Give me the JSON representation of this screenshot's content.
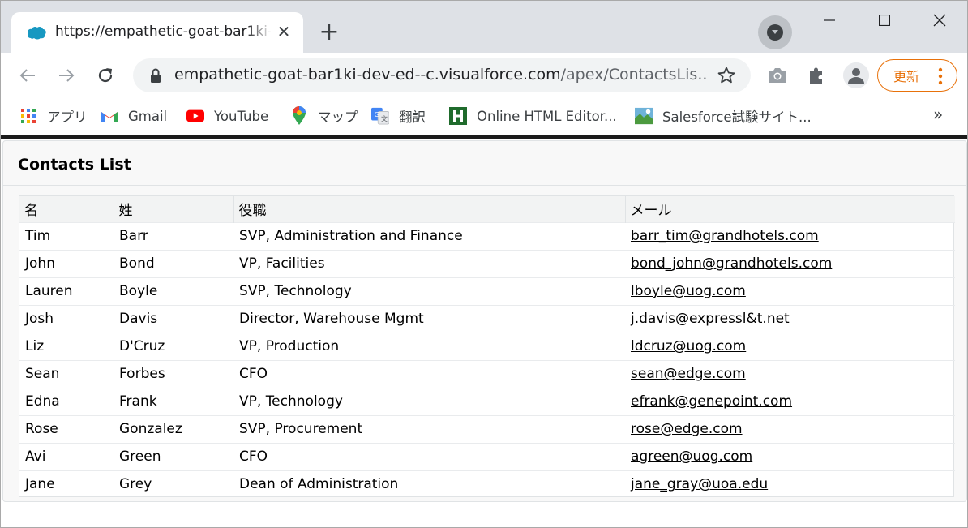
{
  "browser": {
    "tab_title": "https://empathetic-goat-bar1ki-c",
    "tab_close": "✕",
    "new_tab": "+",
    "url_host": "empathetic-goat-bar1ki-dev-ed--c.visualforce.com",
    "url_path": "/apex/ContactsLis...",
    "update_label": "更新"
  },
  "bookmarks": [
    {
      "label": "アプリ",
      "icon": "apps-grid-icon"
    },
    {
      "label": "Gmail",
      "icon": "gmail-icon"
    },
    {
      "label": "YouTube",
      "icon": "youtube-icon"
    },
    {
      "label": "マップ",
      "icon": "maps-pin-icon"
    },
    {
      "label": "翻訳",
      "icon": "translate-icon"
    },
    {
      "label": "Online HTML Editor...",
      "icon": "html-editor-icon"
    },
    {
      "label": "Salesforce試験サイト...",
      "icon": "salesforce-site-icon"
    }
  ],
  "bookmarks_more": "»",
  "page": {
    "title": "Contacts List",
    "columns": [
      "名",
      "姓",
      "役職",
      "メール"
    ],
    "rows": [
      [
        "Tim",
        "Barr",
        "SVP, Administration and Finance",
        "barr_tim@grandhotels.com"
      ],
      [
        "John",
        "Bond",
        "VP, Facilities",
        "bond_john@grandhotels.com"
      ],
      [
        "Lauren",
        "Boyle",
        "SVP, Technology",
        "lboyle@uog.com"
      ],
      [
        "Josh",
        "Davis",
        "Director, Warehouse Mgmt",
        "j.davis@expressl&t.net"
      ],
      [
        "Liz",
        "D'Cruz",
        "VP, Production",
        "ldcruz@uog.com"
      ],
      [
        "Sean",
        "Forbes",
        "CFO",
        "sean@edge.com"
      ],
      [
        "Edna",
        "Frank",
        "VP, Technology",
        "efrank@genepoint.com"
      ],
      [
        "Rose",
        "Gonzalez",
        "SVP, Procurement",
        "rose@edge.com"
      ],
      [
        "Avi",
        "Green",
        "CFO",
        "agreen@uog.com"
      ],
      [
        "Jane",
        "Grey",
        "Dean of Administration",
        "jane_gray@uoa.edu"
      ]
    ]
  },
  "colors": {
    "accent_update": "#e8710a",
    "tab_strip": "#dee1e6",
    "table_header": "#f2f3f3"
  }
}
